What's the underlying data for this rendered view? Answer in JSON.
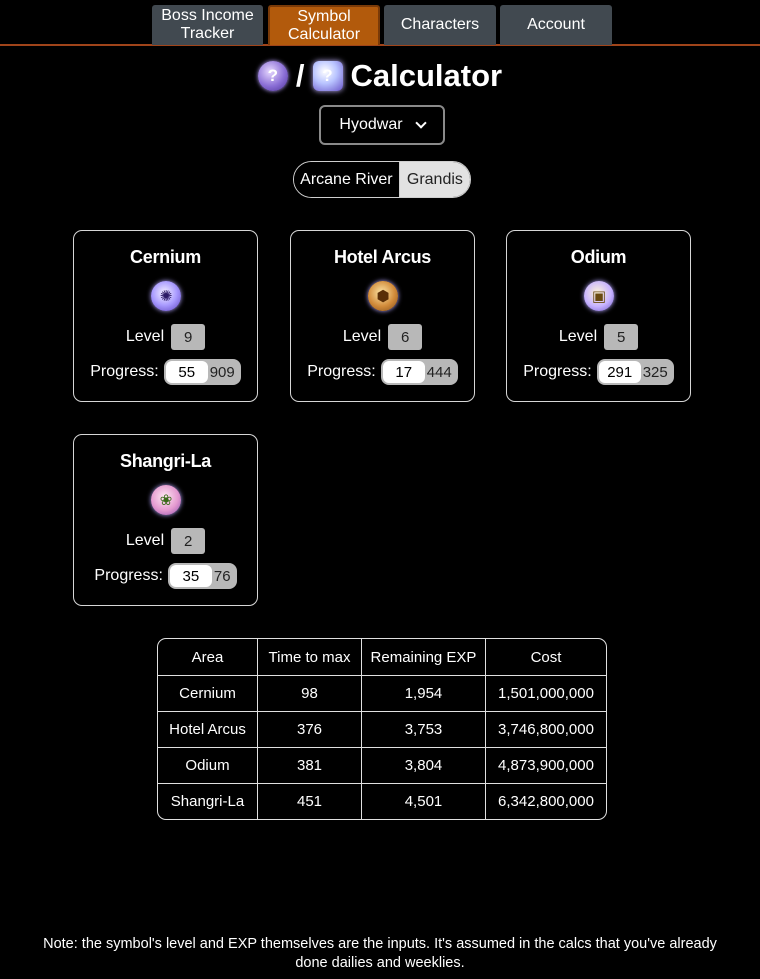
{
  "nav": {
    "tabs": [
      {
        "label_line1": "Boss Income",
        "label_line2": "Tracker"
      },
      {
        "label_line1": "Symbol",
        "label_line2": "Calculator"
      },
      {
        "label": "Characters"
      },
      {
        "label": "Account"
      }
    ],
    "active_tab": 1
  },
  "header": {
    "separator": "/",
    "title": "Calculator",
    "icon_left": "?",
    "icon_right": "?"
  },
  "character_select": {
    "value": "Hyodwar"
  },
  "region_toggle": {
    "left_label": "Arcane River",
    "right_label": "Grandis",
    "selected": "Grandis"
  },
  "labels": {
    "level": "Level",
    "progress": "Progress:"
  },
  "areas": [
    {
      "name": "Cernium",
      "level": "9",
      "progress": "55",
      "max": "909",
      "icon": "cernium-symbol-icon"
    },
    {
      "name": "Hotel Arcus",
      "level": "6",
      "progress": "17",
      "max": "444",
      "icon": "hotel-arcus-symbol-icon"
    },
    {
      "name": "Odium",
      "level": "5",
      "progress": "291",
      "max": "325",
      "icon": "odium-symbol-icon"
    },
    {
      "name": "Shangri-La",
      "level": "2",
      "progress": "35",
      "max": "76",
      "icon": "shangri-la-symbol-icon"
    }
  ],
  "table": {
    "headers": [
      "Area",
      "Time to max",
      "Remaining EXP",
      "Cost"
    ],
    "rows": [
      [
        "Cernium",
        "98",
        "1,954",
        "1,501,000,000"
      ],
      [
        "Hotel Arcus",
        "376",
        "3,753",
        "3,746,800,000"
      ],
      [
        "Odium",
        "381",
        "3,804",
        "4,873,900,000"
      ],
      [
        "Shangri-La",
        "451",
        "4,501",
        "6,342,800,000"
      ]
    ]
  },
  "note": {
    "line1": "Note: the symbol's level and EXP themselves are the inputs. It's assumed in the calcs that you've already",
    "line2": "done dailies and weeklies."
  },
  "colors": {
    "active_tab": "#b25a0c",
    "inactive_tab": "#414950",
    "nav_border": "#a0441a"
  }
}
